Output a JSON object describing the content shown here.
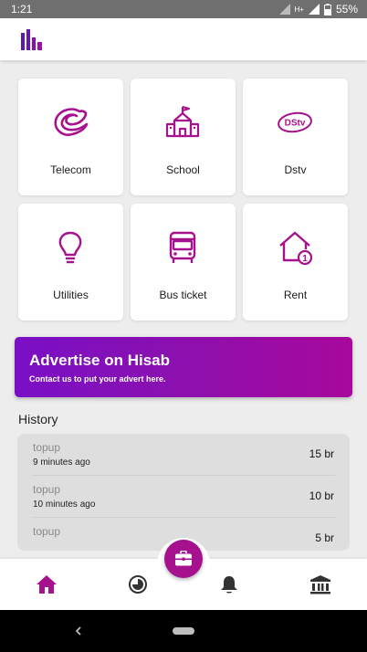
{
  "status_bar": {
    "time": "1:21",
    "network": "H+",
    "battery": "55%"
  },
  "app_bar": {
    "logo_icon": "bars-logo-icon"
  },
  "services": [
    {
      "label": "Telecom",
      "icon": "telecom-logo-icon"
    },
    {
      "label": "School",
      "icon": "school-icon"
    },
    {
      "label": "Dstv",
      "icon": "dstv-logo-icon",
      "icon_text": "DStv"
    },
    {
      "label": "Utilities",
      "icon": "lightbulb-icon"
    },
    {
      "label": "Bus ticket",
      "icon": "bus-icon"
    },
    {
      "label": "Rent",
      "icon": "house-icon",
      "badge": "1"
    }
  ],
  "ad_banner": {
    "title": "Advertise on Hisab",
    "subtitle": "Contact us to put your advert here."
  },
  "history": {
    "title": "History",
    "items": [
      {
        "type": "topup",
        "time": "9 minutes ago",
        "amount": "15 br"
      },
      {
        "type": "topup",
        "time": "10 minutes ago",
        "amount": "10 br"
      },
      {
        "type": "topup",
        "time": "",
        "amount": "5 br"
      }
    ]
  },
  "bottom_nav": {
    "items": [
      {
        "name": "home",
        "icon": "home-icon",
        "active": true
      },
      {
        "name": "history",
        "icon": "clock-icon",
        "active": false
      },
      {
        "name": "notifications",
        "icon": "bell-icon",
        "active": false
      },
      {
        "name": "bank",
        "icon": "bank-icon",
        "active": false
      }
    ],
    "fab_icon": "briefcase-icon"
  },
  "colors": {
    "accent": "#a6118d",
    "banner_start": "#7a0fc6",
    "banner_end": "#a8089c",
    "background": "#ededed"
  }
}
